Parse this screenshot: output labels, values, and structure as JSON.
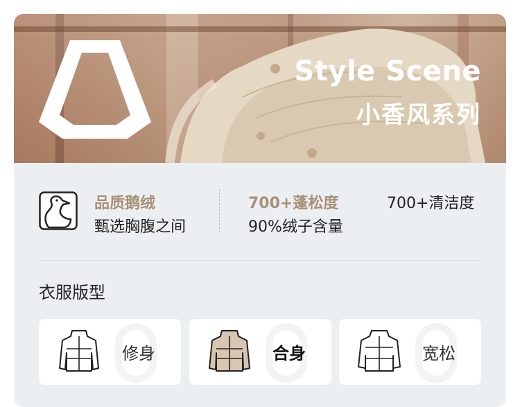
{
  "hero": {
    "title_en": "Style Scene",
    "title_zh": "小香风系列"
  },
  "features": [
    {
      "title": "品质鹅绒",
      "subtitle": "甄选胸腹之间",
      "icon": "goose-icon"
    },
    {
      "title": "700+蓬松度",
      "subtitle": "90%绒子含量"
    },
    {
      "title": "700+清洁度"
    }
  ],
  "section": {
    "title": "衣服版型"
  },
  "fits": [
    {
      "label": "修身",
      "icon": "slim-jacket-icon",
      "selected": false
    },
    {
      "label": "合身",
      "icon": "regular-jacket-icon",
      "selected": true
    },
    {
      "label": "宽松",
      "icon": "loose-jacket-icon",
      "selected": false
    }
  ],
  "colors": {
    "accent": "#a89078",
    "card_bg": "#eceff2",
    "selected_fill": "#d8c6b1"
  }
}
